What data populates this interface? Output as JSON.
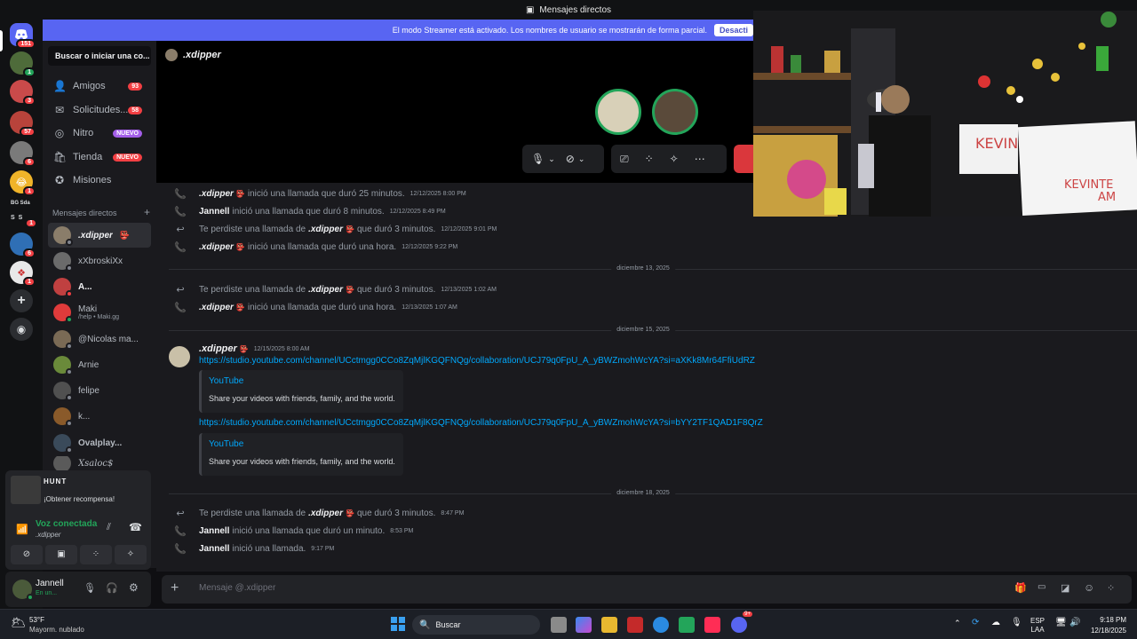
{
  "titlebar": {
    "title": "Mensajes directos"
  },
  "banner": {
    "text": "El modo Streamer está activado. Los nombres de usuario se mostrarán de forma parcial.",
    "button": "Desacti"
  },
  "guilds": [
    {
      "badge": "151"
    },
    {
      "badge": "1"
    },
    {
      "badge": "3"
    },
    {
      "badge": "57"
    },
    {
      "badge": "6"
    },
    {
      "badge": "1"
    },
    {
      "label1": "BG",
      "label2": "Sda"
    },
    {
      "label1": "S",
      "label2": "S",
      "badge": "1"
    },
    {
      "badge": "6"
    },
    {
      "badge": "1"
    }
  ],
  "search": {
    "placeholder": "Buscar o iniciar una co..."
  },
  "nav": [
    {
      "icon": "friends-icon",
      "label": "Amigos",
      "badge": "93"
    },
    {
      "icon": "mail-icon",
      "label": "Solicitudes...",
      "badge": "58"
    },
    {
      "icon": "nitro-icon",
      "label": "Nitro",
      "tag": "NUEVO"
    },
    {
      "icon": "shop-icon",
      "label": "Tienda",
      "tag": "NUEVO"
    },
    {
      "icon": "quest-icon",
      "label": "Misiones"
    }
  ],
  "dm_header": {
    "label": "Mensajes directos",
    "add": "+"
  },
  "dms": [
    {
      "name": ".xdipper",
      "sub": ""
    },
    {
      "name": "xXbroskiXx",
      "sub": ""
    },
    {
      "name": "A...",
      "sub": ""
    },
    {
      "name": "Maki",
      "sub": "/help • Maki.gg"
    },
    {
      "name": "@Nicolas ma...",
      "sub": ""
    },
    {
      "name": "Arnie",
      "sub": ""
    },
    {
      "name": "felipe",
      "sub": ""
    },
    {
      "name": "k...",
      "sub": ""
    },
    {
      "name": "Ovalplay...",
      "sub": ""
    },
    {
      "name": "Xsaloc$",
      "sub": ""
    }
  ],
  "voice": {
    "game": "HUNT",
    "reward": "¡Obtener recompensa!",
    "status": "Voz conectada",
    "channel": ".xdipper"
  },
  "user": {
    "name": "Jannell",
    "status": "En un..."
  },
  "call": {
    "name": ".xdipper"
  },
  "messages": [
    {
      "type": "call",
      "user": ".xdipper",
      "text": "inició una llamada que duró 25 minutos.",
      "ts": "12/12/2025 8:00 PM"
    },
    {
      "type": "call",
      "user": "Jannell",
      "text": "inició una llamada que duró 8 minutos.",
      "ts": "12/12/2025 8:49 PM"
    },
    {
      "type": "missed",
      "pre": "Te perdiste una llamada de",
      "user": ".xdipper",
      "text": "que duró 3 minutos.",
      "ts": "12/12/2025 9:01 PM"
    },
    {
      "type": "call",
      "user": ".xdipper",
      "text": "inició una llamada que duró una hora.",
      "ts": "12/12/2025 9:22 PM"
    },
    {
      "type": "missed",
      "pre": "Te perdiste una llamada de",
      "user": ".xdipper",
      "text": "que duró 3 minutos.",
      "ts": "12/13/2025 1:02 AM"
    },
    {
      "type": "call",
      "user": ".xdipper",
      "text": "inició una llamada que duró una hora.",
      "ts": "12/13/2025 1:07 AM"
    },
    {
      "type": "missed",
      "pre": "Te perdiste una llamada de",
      "user": ".xdipper",
      "text": "que duró 3 minutos.",
      "ts": "8:47 PM"
    },
    {
      "type": "call",
      "user": "Jannell",
      "text": "inició una llamada que duró un minuto.",
      "ts": "8:53 PM"
    },
    {
      "type": "call",
      "user": "Jannell",
      "text": "inició una llamada.",
      "ts": "9:17 PM"
    }
  ],
  "dividers": [
    "diciembre 13, 2025",
    "diciembre 15, 2025",
    "diciembre 18, 2025"
  ],
  "post": {
    "user": ".xdipper",
    "ts": "12/15/2025 8:00 AM",
    "link1": "https://studio.youtube.com/channel/UCctmgg0CCo8ZqMjlKGQFNQg/collaboration/UCJ79q0FpU_A_yBWZmohWcYA?si=aXKk8Mr64FfiUdRZ",
    "link2": "https://studio.youtube.com/channel/UCctmgg0CCo8ZqMjlKGQFNQg/collaboration/UCJ79q0FpU_A_yBWZmohWcYA?si=bYY2TF1QAD1F8QrZ",
    "embed_title": "YouTube",
    "embed_desc": "Share your videos with friends, family, and the world."
  },
  "composer": {
    "placeholder": "Mensaje @.xdipper"
  },
  "taskbar": {
    "temp": "53°F",
    "weather": "Mayorm. nublado",
    "search": "Buscar",
    "lang1": "ESP",
    "lang2": "LAA",
    "time": "9:18 PM",
    "date": "12/18/2025",
    "discord_badge": "9+"
  },
  "colors": {
    "accent": "#5865f2",
    "green": "#23a55a",
    "red": "#f23f43",
    "link": "#00a8fc",
    "nitro": "#a35ee8"
  }
}
